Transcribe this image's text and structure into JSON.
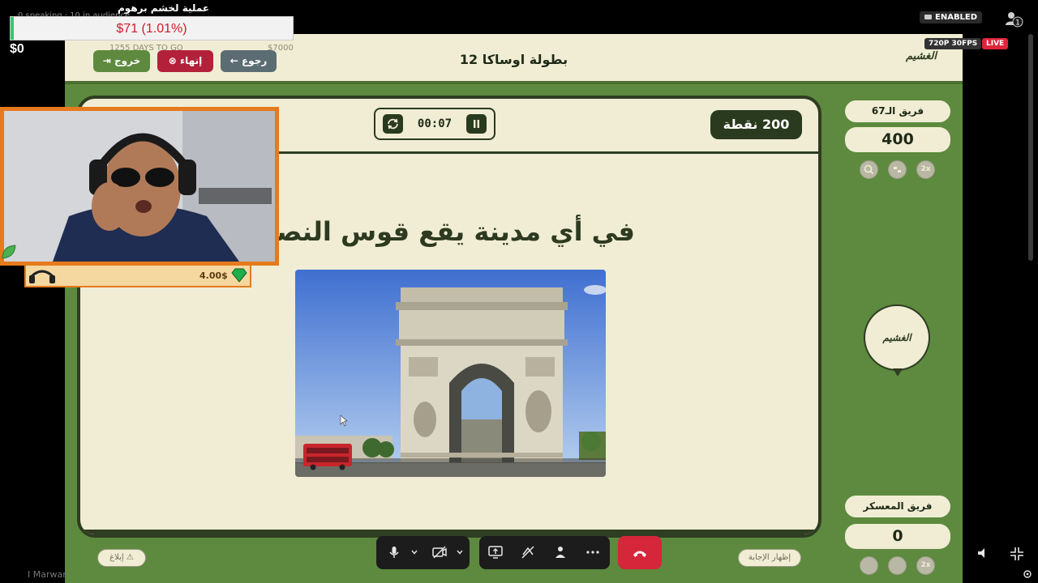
{
  "overlay": {
    "title": "عملية لخشم برهوم",
    "goal_text": "$71 (1.01%)",
    "goal_fraction": 0.0101,
    "current_amount": "$0",
    "sub_hint": "0 speaking · 10 in audience"
  },
  "stream": {
    "enabled_label": "ENABLED",
    "quality_label": "720P 30FPS",
    "live_label": "LIVE",
    "people_count": "1"
  },
  "header": {
    "logo": "الغشيم",
    "title": "بطولة اوساكا 12",
    "back_label": "رجوع",
    "end_label": "إنهاء",
    "exit_label": "خروج",
    "ghost_text": "1255 DAYS TO GO",
    "ghost_amount": "$7000"
  },
  "question_panel": {
    "points": "200 نقطة",
    "timer": "00:07",
    "question": "في أي مدينة يقع قوس النصر"
  },
  "teams": [
    {
      "name": "فريق الـ67",
      "score": "400"
    },
    {
      "name": "فريق المعسكر",
      "score": "0"
    }
  ],
  "tools": [
    "search-icon",
    "phone-swap-icon",
    "2x"
  ],
  "side_logo": "الغشيم",
  "buttons": {
    "report": "إبلاغ",
    "reveal": "إظهار الإجابة"
  },
  "webcam": {
    "tag_value": "4.00$"
  },
  "footer": {
    "name_tag": "I Marwan"
  },
  "colors": {
    "panel_bg": "#f0edd4",
    "game_green": "#5d8a3e",
    "dark_green": "#2a3a1e",
    "danger": "#b3203a",
    "end_call": "#d6263a",
    "cam_border": "#e67a1c"
  }
}
